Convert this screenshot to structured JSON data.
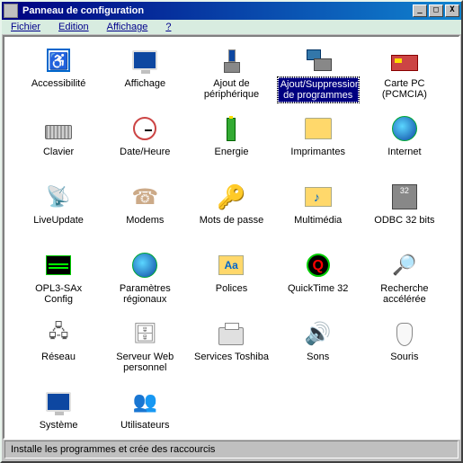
{
  "window": {
    "title": "Panneau de configuration"
  },
  "menu": {
    "file": "Fichier",
    "edit": "Edition",
    "view": "Affichage",
    "help": "?"
  },
  "items": [
    {
      "label": "Accessibilité",
      "icon": "ic-access",
      "name": "accessibility"
    },
    {
      "label": "Affichage",
      "icon": "ic-monitor",
      "name": "display"
    },
    {
      "label": "Ajout de périphérique",
      "icon": "ic-xfer",
      "name": "add-hardware"
    },
    {
      "label": "Ajout/Suppression de programmes",
      "icon": "ic-addprog",
      "name": "add-remove-programs",
      "selected": true
    },
    {
      "label": "Carte PC (PCMCIA)",
      "icon": "ic-card",
      "name": "pcmcia"
    },
    {
      "label": "Clavier",
      "icon": "ic-keyboard",
      "name": "keyboard"
    },
    {
      "label": "Date/Heure",
      "icon": "ic-clock",
      "name": "date-time"
    },
    {
      "label": "Energie",
      "icon": "ic-energy",
      "name": "power"
    },
    {
      "label": "Imprimantes",
      "icon": "ic-folder",
      "name": "printers"
    },
    {
      "label": "Internet",
      "icon": "ic-globe",
      "name": "internet"
    },
    {
      "label": "LiveUpdate",
      "icon": "ic-live",
      "name": "liveupdate"
    },
    {
      "label": "Modems",
      "icon": "ic-modem",
      "name": "modems"
    },
    {
      "label": "Mots de passe",
      "icon": "ic-key",
      "name": "passwords"
    },
    {
      "label": "Multimédia",
      "icon": "ic-multi",
      "name": "multimedia"
    },
    {
      "label": "ODBC 32 bits",
      "icon": "ic-odbc",
      "name": "odbc"
    },
    {
      "label": "OPL3-SAx Config",
      "icon": "ic-opl",
      "name": "opl3"
    },
    {
      "label": "Paramètres régionaux",
      "icon": "ic-globe",
      "name": "regional"
    },
    {
      "label": "Polices",
      "icon": "ic-police",
      "name": "fonts"
    },
    {
      "label": "QuickTime 32",
      "icon": "ic-qt",
      "name": "quicktime"
    },
    {
      "label": "Recherche accélérée",
      "icon": "ic-search",
      "name": "findfast"
    },
    {
      "label": "Réseau",
      "icon": "ic-net",
      "name": "network"
    },
    {
      "label": "Serveur Web personnel",
      "icon": "ic-serv",
      "name": "pws"
    },
    {
      "label": "Services Toshiba",
      "icon": "ic-printer",
      "name": "toshiba"
    },
    {
      "label": "Sons",
      "icon": "ic-speaker",
      "name": "sounds"
    },
    {
      "label": "Souris",
      "icon": "ic-mouse",
      "name": "mouse"
    },
    {
      "label": "Système",
      "icon": "ic-monitor",
      "name": "system"
    },
    {
      "label": "Utilisateurs",
      "icon": "ic-user",
      "name": "users"
    }
  ],
  "status": "Installe les programmes et crée des raccourcis",
  "colors": {
    "selection": "#000080",
    "menuText": "#00008b"
  }
}
